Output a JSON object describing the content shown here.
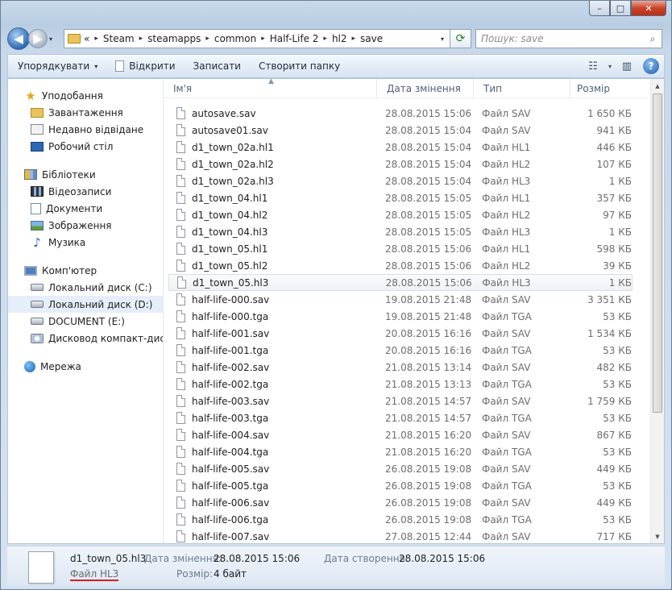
{
  "window": {
    "min": "–",
    "max": "□",
    "close": "✕"
  },
  "nav": {
    "back": "◀",
    "forward": "▶",
    "drop": "▾"
  },
  "address": {
    "overflow": "«",
    "crumbs": [
      "Steam",
      "steamapps",
      "common",
      "Half-Life 2",
      "hl2",
      "save"
    ],
    "sep": "▸",
    "drop": "▾",
    "refresh": "⟳"
  },
  "search": {
    "placeholder": "Пошук: save",
    "icon": "⌕"
  },
  "toolbar": {
    "organize": "Упорядкувати",
    "open": "Відкрити",
    "burn": "Записати",
    "new_folder": "Створити папку",
    "view_icon": "☷",
    "view_drop": "▾",
    "pane_icon": "▥",
    "help": "?"
  },
  "sidebar": {
    "favorites": "Уподобання",
    "downloads": "Завантаження",
    "recent": "Недавно відвідане",
    "desktop": "Робочий стіл",
    "libraries": "Бібліотеки",
    "videos": "Відеозаписи",
    "documents": "Документи",
    "pictures": "Зображення",
    "music": "Музика",
    "computer": "Комп'ютер",
    "disk_c": "Локальний диск (C:)",
    "disk_d": "Локальний диск (D:)",
    "disk_e": "DOCUMENT (E:)",
    "dvd": "Дисковод компакт-дисків",
    "network": "Мережа"
  },
  "columns": {
    "name": "Ім'я",
    "date": "Дата змінення",
    "type": "Тип",
    "size": "Розмір"
  },
  "files": [
    {
      "name": "autosave.sav",
      "date": "28.08.2015 15:06",
      "type": "Файл SAV",
      "size": "1 650 КБ"
    },
    {
      "name": "autosave01.sav",
      "date": "28.08.2015 15:04",
      "type": "Файл SAV",
      "size": "941 КБ"
    },
    {
      "name": "d1_town_02a.hl1",
      "date": "28.08.2015 15:04",
      "type": "Файл HL1",
      "size": "446 КБ"
    },
    {
      "name": "d1_town_02a.hl2",
      "date": "28.08.2015 15:04",
      "type": "Файл HL2",
      "size": "107 КБ"
    },
    {
      "name": "d1_town_02a.hl3",
      "date": "28.08.2015 15:04",
      "type": "Файл HL3",
      "size": "1 КБ"
    },
    {
      "name": "d1_town_04.hl1",
      "date": "28.08.2015 15:05",
      "type": "Файл HL1",
      "size": "357 КБ"
    },
    {
      "name": "d1_town_04.hl2",
      "date": "28.08.2015 15:05",
      "type": "Файл HL2",
      "size": "97 КБ"
    },
    {
      "name": "d1_town_04.hl3",
      "date": "28.08.2015 15:05",
      "type": "Файл HL3",
      "size": "1 КБ"
    },
    {
      "name": "d1_town_05.hl1",
      "date": "28.08.2015 15:06",
      "type": "Файл HL1",
      "size": "598 КБ"
    },
    {
      "name": "d1_town_05.hl2",
      "date": "28.08.2015 15:06",
      "type": "Файл HL2",
      "size": "39 КБ"
    },
    {
      "name": "d1_town_05.hl3",
      "date": "28.08.2015 15:06",
      "type": "Файл HL3",
      "size": "1 КБ"
    },
    {
      "name": "half-life-000.sav",
      "date": "19.08.2015 21:48",
      "type": "Файл SAV",
      "size": "3 351 КБ"
    },
    {
      "name": "half-life-000.tga",
      "date": "19.08.2015 21:48",
      "type": "Файл TGA",
      "size": "53 КБ"
    },
    {
      "name": "half-life-001.sav",
      "date": "20.08.2015 16:16",
      "type": "Файл SAV",
      "size": "1 534 КБ"
    },
    {
      "name": "half-life-001.tga",
      "date": "20.08.2015 16:16",
      "type": "Файл TGA",
      "size": "53 КБ"
    },
    {
      "name": "half-life-002.sav",
      "date": "21.08.2015 13:14",
      "type": "Файл SAV",
      "size": "482 КБ"
    },
    {
      "name": "half-life-002.tga",
      "date": "21.08.2015 13:13",
      "type": "Файл TGA",
      "size": "53 КБ"
    },
    {
      "name": "half-life-003.sav",
      "date": "21.08.2015 14:57",
      "type": "Файл SAV",
      "size": "1 759 КБ"
    },
    {
      "name": "half-life-003.tga",
      "date": "21.08.2015 14:57",
      "type": "Файл TGA",
      "size": "53 КБ"
    },
    {
      "name": "half-life-004.sav",
      "date": "21.08.2015 16:20",
      "type": "Файл SAV",
      "size": "867 КБ"
    },
    {
      "name": "half-life-004.tga",
      "date": "21.08.2015 16:20",
      "type": "Файл TGA",
      "size": "53 КБ"
    },
    {
      "name": "half-life-005.sav",
      "date": "26.08.2015 19:08",
      "type": "Файл SAV",
      "size": "449 КБ"
    },
    {
      "name": "half-life-005.tga",
      "date": "26.08.2015 19:08",
      "type": "Файл TGA",
      "size": "53 КБ"
    },
    {
      "name": "half-life-006.sav",
      "date": "26.08.2015 19:08",
      "type": "Файл SAV",
      "size": "449 КБ"
    },
    {
      "name": "half-life-006.tga",
      "date": "26.08.2015 19:08",
      "type": "Файл TGA",
      "size": "53 КБ"
    },
    {
      "name": "half-life-007.sav",
      "date": "27.08.2015 12:44",
      "type": "Файл SAV",
      "size": "717 КБ"
    }
  ],
  "selected_index": 10,
  "details": {
    "name": "d1_town_05.hl3",
    "type": "Файл HL3",
    "modified_label": "Дата змінення:",
    "modified": "28.08.2015 15:06",
    "created_label": "Дата створення:",
    "created": "28.08.2015 15:06",
    "size_label": "Розмір:",
    "size": "4 байт"
  },
  "colors": {
    "accent": "#2e6bb3",
    "underline": "#d61f1f",
    "selection": "#e5eef9"
  }
}
